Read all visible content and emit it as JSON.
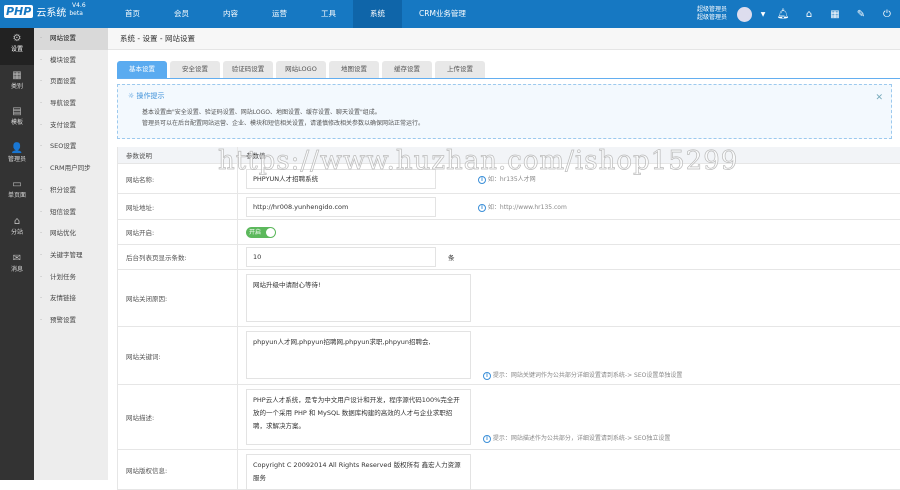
{
  "header": {
    "logo": "PHP",
    "product": "云系统",
    "version": "V4.6",
    "beta": "beta",
    "nav": [
      "首页",
      "会员",
      "内容",
      "运营",
      "工具",
      "系统",
      "CRM业务管理"
    ],
    "active_nav": 5,
    "user_role": "超级管理员",
    "user_name": "超级管理员"
  },
  "sidebar": [
    {
      "label": "设置",
      "icon": "⚙"
    },
    {
      "label": "类别",
      "icon": "▦"
    },
    {
      "label": "模板",
      "icon": "▤"
    },
    {
      "label": "管理员",
      "icon": "👤"
    },
    {
      "label": "单页面",
      "icon": "▭"
    },
    {
      "label": "分站",
      "icon": "⌂"
    },
    {
      "label": "消息",
      "icon": "✉"
    }
  ],
  "submenu": [
    "网站设置",
    "模块设置",
    "页面设置",
    "导航设置",
    "支付设置",
    "SEO设置",
    "CRM用户同步",
    "积分设置",
    "短信设置",
    "网站优化",
    "关键字管理",
    "计划任务",
    "友情链接",
    "预警设置"
  ],
  "breadcrumb": "系统 - 设置 - 网站设置",
  "tabs": [
    "基本设置",
    "安全设置",
    "验证码设置",
    "网站LOGO",
    "地图设置",
    "缓存设置",
    "上传设置"
  ],
  "tip": {
    "title": "操作提示",
    "lines": [
      "基本设置由\"安全设置、验证码设置、网站LOGO、地图设置、缓存设置、聊天设置\"组成。",
      "管理员可以在后台配置网站运营、企业、模块和短信相关设置，请谨慎修改相关参数以确保网站正常运行。"
    ]
  },
  "table": {
    "col1": "参数说明",
    "col2": "参数值",
    "site_name": {
      "label": "网站名称:",
      "value": "PHPYUN人才招聘系统",
      "hint": "如：hr135人才网"
    },
    "site_url": {
      "label": "网址地址:",
      "value": "http://hr008.yunhengido.com",
      "hint": "如：http://www.hr135.com"
    },
    "site_open": {
      "label": "网站开启:",
      "value": "开启"
    },
    "page_size": {
      "label": "后台列表页显示条数:",
      "value": "10",
      "unit": "条"
    },
    "close_reason": {
      "label": "网站关闭原因:",
      "value": "网站升级中请耐心等待!"
    },
    "keywords": {
      "label": "网站关键词:",
      "value": "phpyun人才网,phpyun招聘网,phpyun求职,phpyun招聘会,",
      "hint": "提示：网站关键词作为公共部分详细设置请到系统-> SEO设置单独设置"
    },
    "description": {
      "label": "网站描述:",
      "value": "PHP云人才系统，是专为中文用户设计和开发，程序源代码100%完全开放的一个采用 PHP 和 MySQL 数据库构建的高效的人才与企业求职招聘，求解决方案。",
      "hint": "提示：网站描述作为公共部分，详细设置请到系统-> SEO独立设置"
    },
    "copyright": {
      "label": "网站版权信息:",
      "value": "Copyright C 20092014 All Rights Reserved 版权所有 鑫宏人力资源服务"
    }
  },
  "watermark": "https://www.huzhan.com/ishop15299"
}
